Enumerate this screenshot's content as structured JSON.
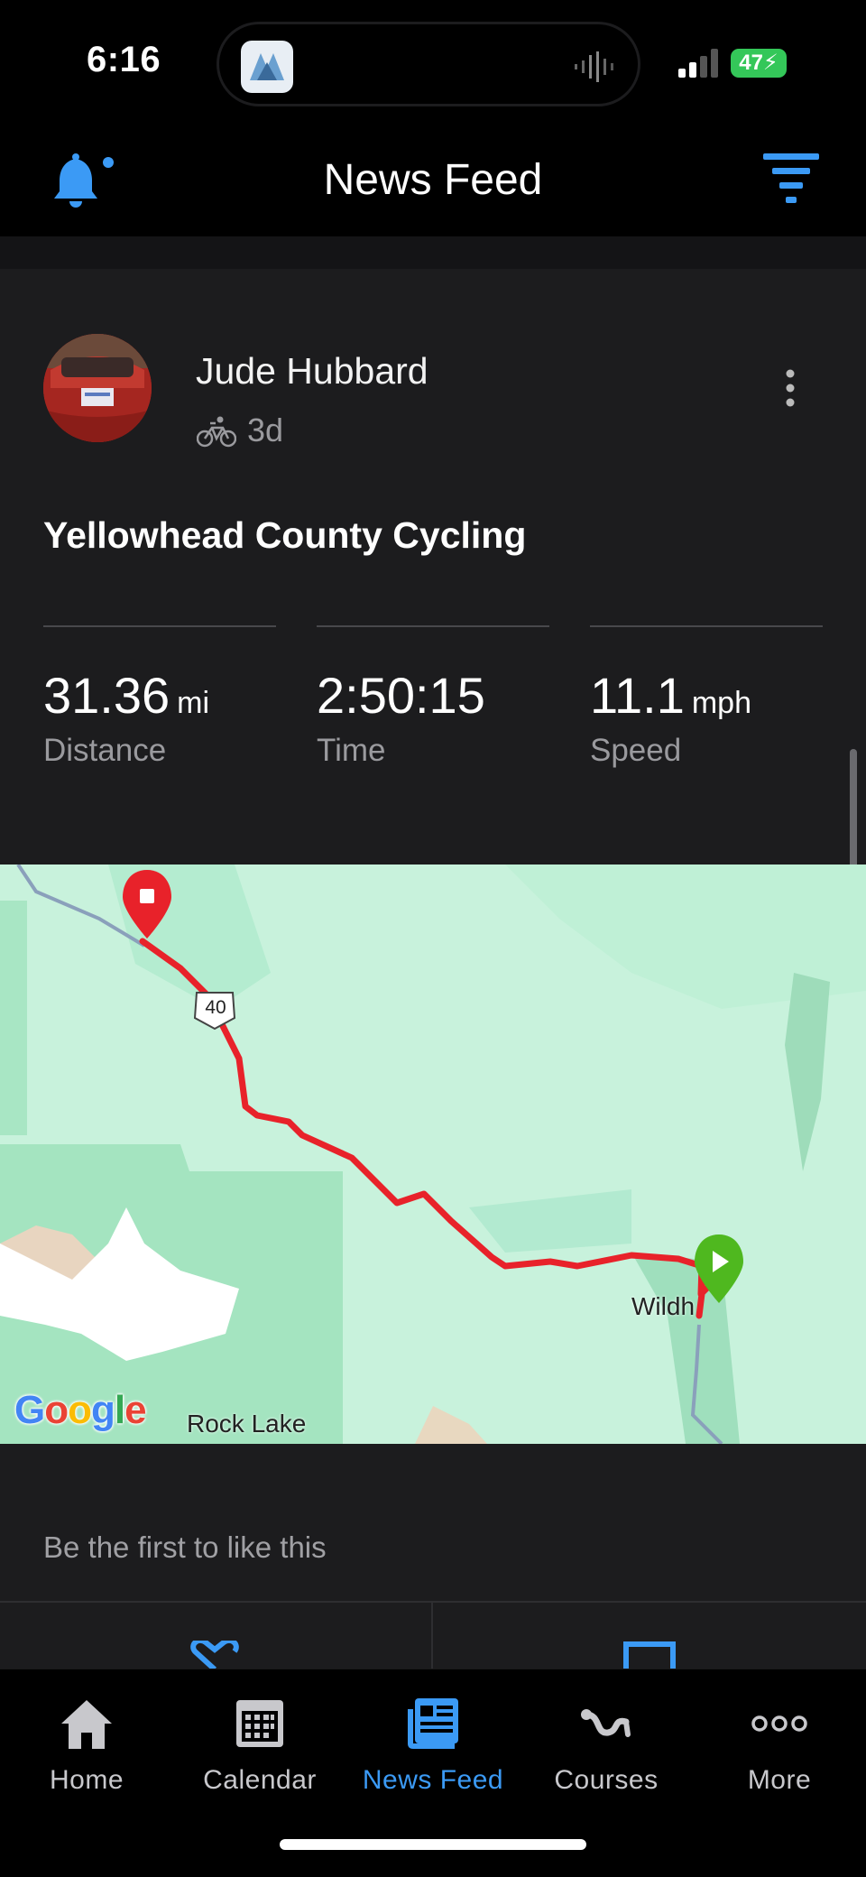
{
  "status_bar": {
    "time": "6:16",
    "battery": "47"
  },
  "header": {
    "title": "News Feed"
  },
  "post": {
    "user_name": "Jude Hubbard",
    "age": "3d",
    "activity_title": "Yellowhead County Cycling",
    "stats": [
      {
        "value": "31.36",
        "unit": "mi",
        "label": "Distance"
      },
      {
        "value": "2:50:15",
        "unit": "",
        "label": "Time"
      },
      {
        "value": "11.1",
        "unit": "mph",
        "label": "Speed"
      }
    ],
    "map": {
      "route_color": "#e8222a",
      "highway_shield": "40",
      "place_labels": [
        "Wildh",
        "Rock Lake"
      ],
      "attribution": "Google"
    },
    "likes_text": "Be the first to like this"
  },
  "tabs": [
    {
      "label": "Home",
      "icon": "home-icon"
    },
    {
      "label": "Calendar",
      "icon": "calendar-icon"
    },
    {
      "label": "News Feed",
      "icon": "news-feed-icon",
      "active": true
    },
    {
      "label": "Courses",
      "icon": "courses-icon"
    },
    {
      "label": "More",
      "icon": "more-icon"
    }
  ],
  "colors": {
    "accent": "#3b9af5",
    "background": "#000000",
    "card": "#1c1c1e"
  }
}
